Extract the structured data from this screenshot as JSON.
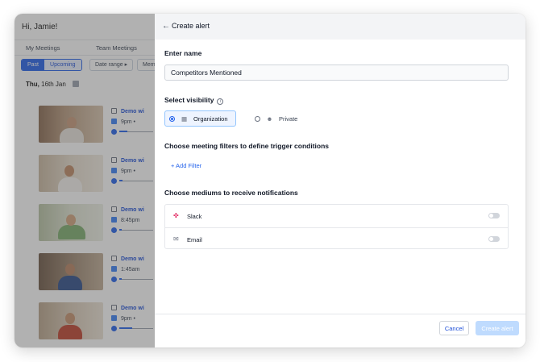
{
  "background": {
    "greeting": "Hi, Jamie!",
    "tabs": [
      "My Meetings",
      "Team Meetings"
    ],
    "segment": {
      "past": "Past",
      "upcoming": "Upcoming"
    },
    "date_range": "Date range ▸",
    "members": "Mem",
    "date": {
      "day": "Thu,",
      "rest": "16th Jan"
    },
    "meetings": [
      {
        "title": "Demo wi",
        "time": "9pm •"
      },
      {
        "title": "Demo wi",
        "time": "9pm •"
      },
      {
        "title": "Demo wi",
        "time": "8:45pm"
      },
      {
        "title": "Demo wi",
        "time": "1:45am"
      },
      {
        "title": "Demo wi",
        "time": "9pm •"
      }
    ]
  },
  "panel": {
    "back_icon": "arrow-left-icon",
    "title": "Create alert",
    "name_label": "Enter name",
    "name_value": "Competitors Mentioned",
    "visibility_label": "Select visibility",
    "visibility_options": [
      {
        "label": "Organization",
        "icon": "building-icon",
        "selected": true
      },
      {
        "label": "Private",
        "icon": "user-lock-icon",
        "selected": false
      }
    ],
    "filters_label": "Choose meeting filters to define trigger conditions",
    "add_filter": "+ Add Filter",
    "mediums_label": "Choose mediums to receive notifications",
    "mediums": [
      {
        "label": "Slack",
        "icon": "slack-icon",
        "enabled": false
      },
      {
        "label": "Email",
        "icon": "mail-icon",
        "enabled": false
      }
    ],
    "cancel": "Cancel",
    "create": "Create alert"
  },
  "colors": {
    "accent": "#2563eb",
    "disabled": "#bfdbfe"
  }
}
